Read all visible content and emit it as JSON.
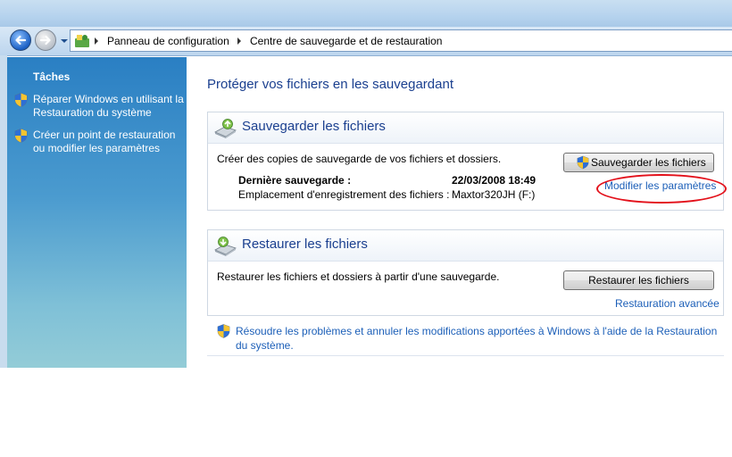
{
  "navigation": {
    "breadcrumb": [
      "Panneau de configuration",
      "Centre de sauvegarde et de restauration"
    ]
  },
  "sidebar": {
    "title": "Tâches",
    "tasks": [
      {
        "label": "Réparer Windows en utilisant la Restauration du système"
      },
      {
        "label": "Créer un point de restauration ou modifier les paramètres"
      }
    ]
  },
  "main": {
    "title": "Protéger vos fichiers en les sauvegardant",
    "backup": {
      "heading": "Sauvegarder les fichiers",
      "description": "Créer des copies de sauvegarde de vos fichiers et dossiers.",
      "last_backup_label": "Dernière sauvegarde :",
      "last_backup_value": "22/03/2008 18:49",
      "location_label": "Emplacement d'enregistrement des fichiers :",
      "location_value": "Maxtor320JH (F:)",
      "button": "Sauvegarder les fichiers",
      "settings_link": "Modifier les paramètres"
    },
    "restore": {
      "heading": "Restaurer les fichiers",
      "description": "Restaurer les fichiers et dossiers à partir d'une sauvegarde.",
      "button": "Restaurer les fichiers",
      "advanced_link": "Restauration avancée"
    },
    "footer_link": "Résoudre les problèmes et annuler les modifications apportées à Windows à l'aide de la Restauration du système."
  },
  "icons": {
    "back": "back-arrow-icon",
    "forward": "forward-arrow-icon",
    "shield": "uac-shield-icon",
    "backup": "backup-drive-icon",
    "restore": "restore-drive-icon",
    "control_panel": "control-panel-icon"
  },
  "colors": {
    "heading_blue": "#1a3f8f",
    "link_blue": "#1c5fb8",
    "task_pane": "#2a7fc3",
    "highlight_ellipse": "#e3111b"
  }
}
